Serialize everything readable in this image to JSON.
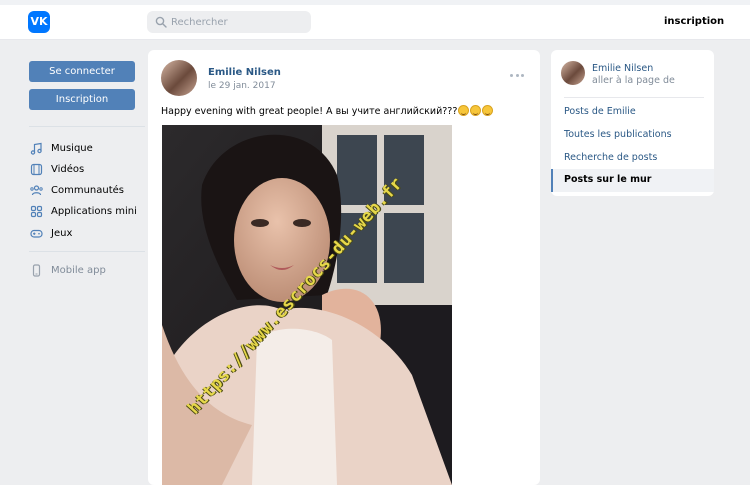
{
  "header": {
    "logo_text": "VK",
    "search_placeholder": "Rechercher",
    "signup_label": "inscription"
  },
  "sidebar": {
    "login_label": "Se connecter",
    "register_label": "Inscription",
    "items": [
      {
        "label": "Musique",
        "icon": "music-icon"
      },
      {
        "label": "Vidéos",
        "icon": "video-icon"
      },
      {
        "label": "Communautés",
        "icon": "communities-icon"
      },
      {
        "label": "Applications mini",
        "icon": "apps-icon"
      },
      {
        "label": "Jeux",
        "icon": "gamepad-icon"
      }
    ],
    "mobile_label": "Mobile app"
  },
  "post": {
    "author": "Emilie Nilsen",
    "date": "le 29 jan. 2017",
    "text": "Happy evening with great people! А вы учите английский???",
    "emoji_count": 3,
    "watermark": "https://www.escrocs-du-web.fr"
  },
  "right": {
    "name": "Emilie Nilsen",
    "sub": "aller à la page de",
    "links": [
      "Posts de Emilie",
      "Toutes les publications",
      "Recherche de posts"
    ],
    "active": "Posts sur le mur"
  },
  "colors": {
    "brand": "#0077ff",
    "button": "#5181b8",
    "link": "#2a5885",
    "background": "#edeef0"
  }
}
